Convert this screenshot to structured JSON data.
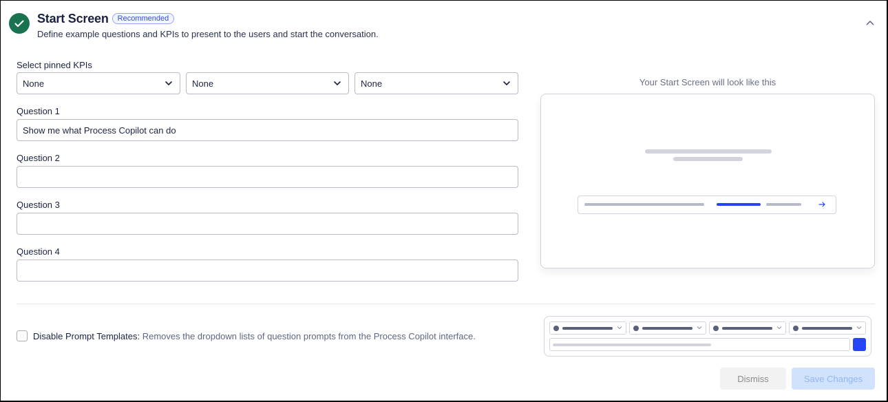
{
  "header": {
    "title": "Start Screen",
    "badge": "Recommended",
    "subtitle": "Define example questions and KPIs to present to the users and start the conversation.",
    "status_icon": "check-circle-icon",
    "collapse_icon": "chevron-up-icon"
  },
  "kpis": {
    "label": "Select pinned KPIs",
    "selects": [
      {
        "value": "None"
      },
      {
        "value": "None"
      },
      {
        "value": "None"
      }
    ]
  },
  "questions": [
    {
      "label": "Question 1",
      "value": "Show me what Process Copilot can do"
    },
    {
      "label": "Question 2",
      "value": ""
    },
    {
      "label": "Question 3",
      "value": ""
    },
    {
      "label": "Question 4",
      "value": ""
    }
  ],
  "preview": {
    "caption": "Your Start Screen will look like this",
    "send_icon": "arrow-right-icon"
  },
  "prompt_templates": {
    "checked": false,
    "label": "Disable Prompt Templates:",
    "description": "Removes the dropdown lists of question prompts from the Process Copilot interface."
  },
  "footer": {
    "dismiss_label": "Dismiss",
    "save_label": "Save Changes"
  },
  "colors": {
    "success": "#1a7350",
    "accent": "#2546f5",
    "badge_text": "#2f4fd6"
  }
}
